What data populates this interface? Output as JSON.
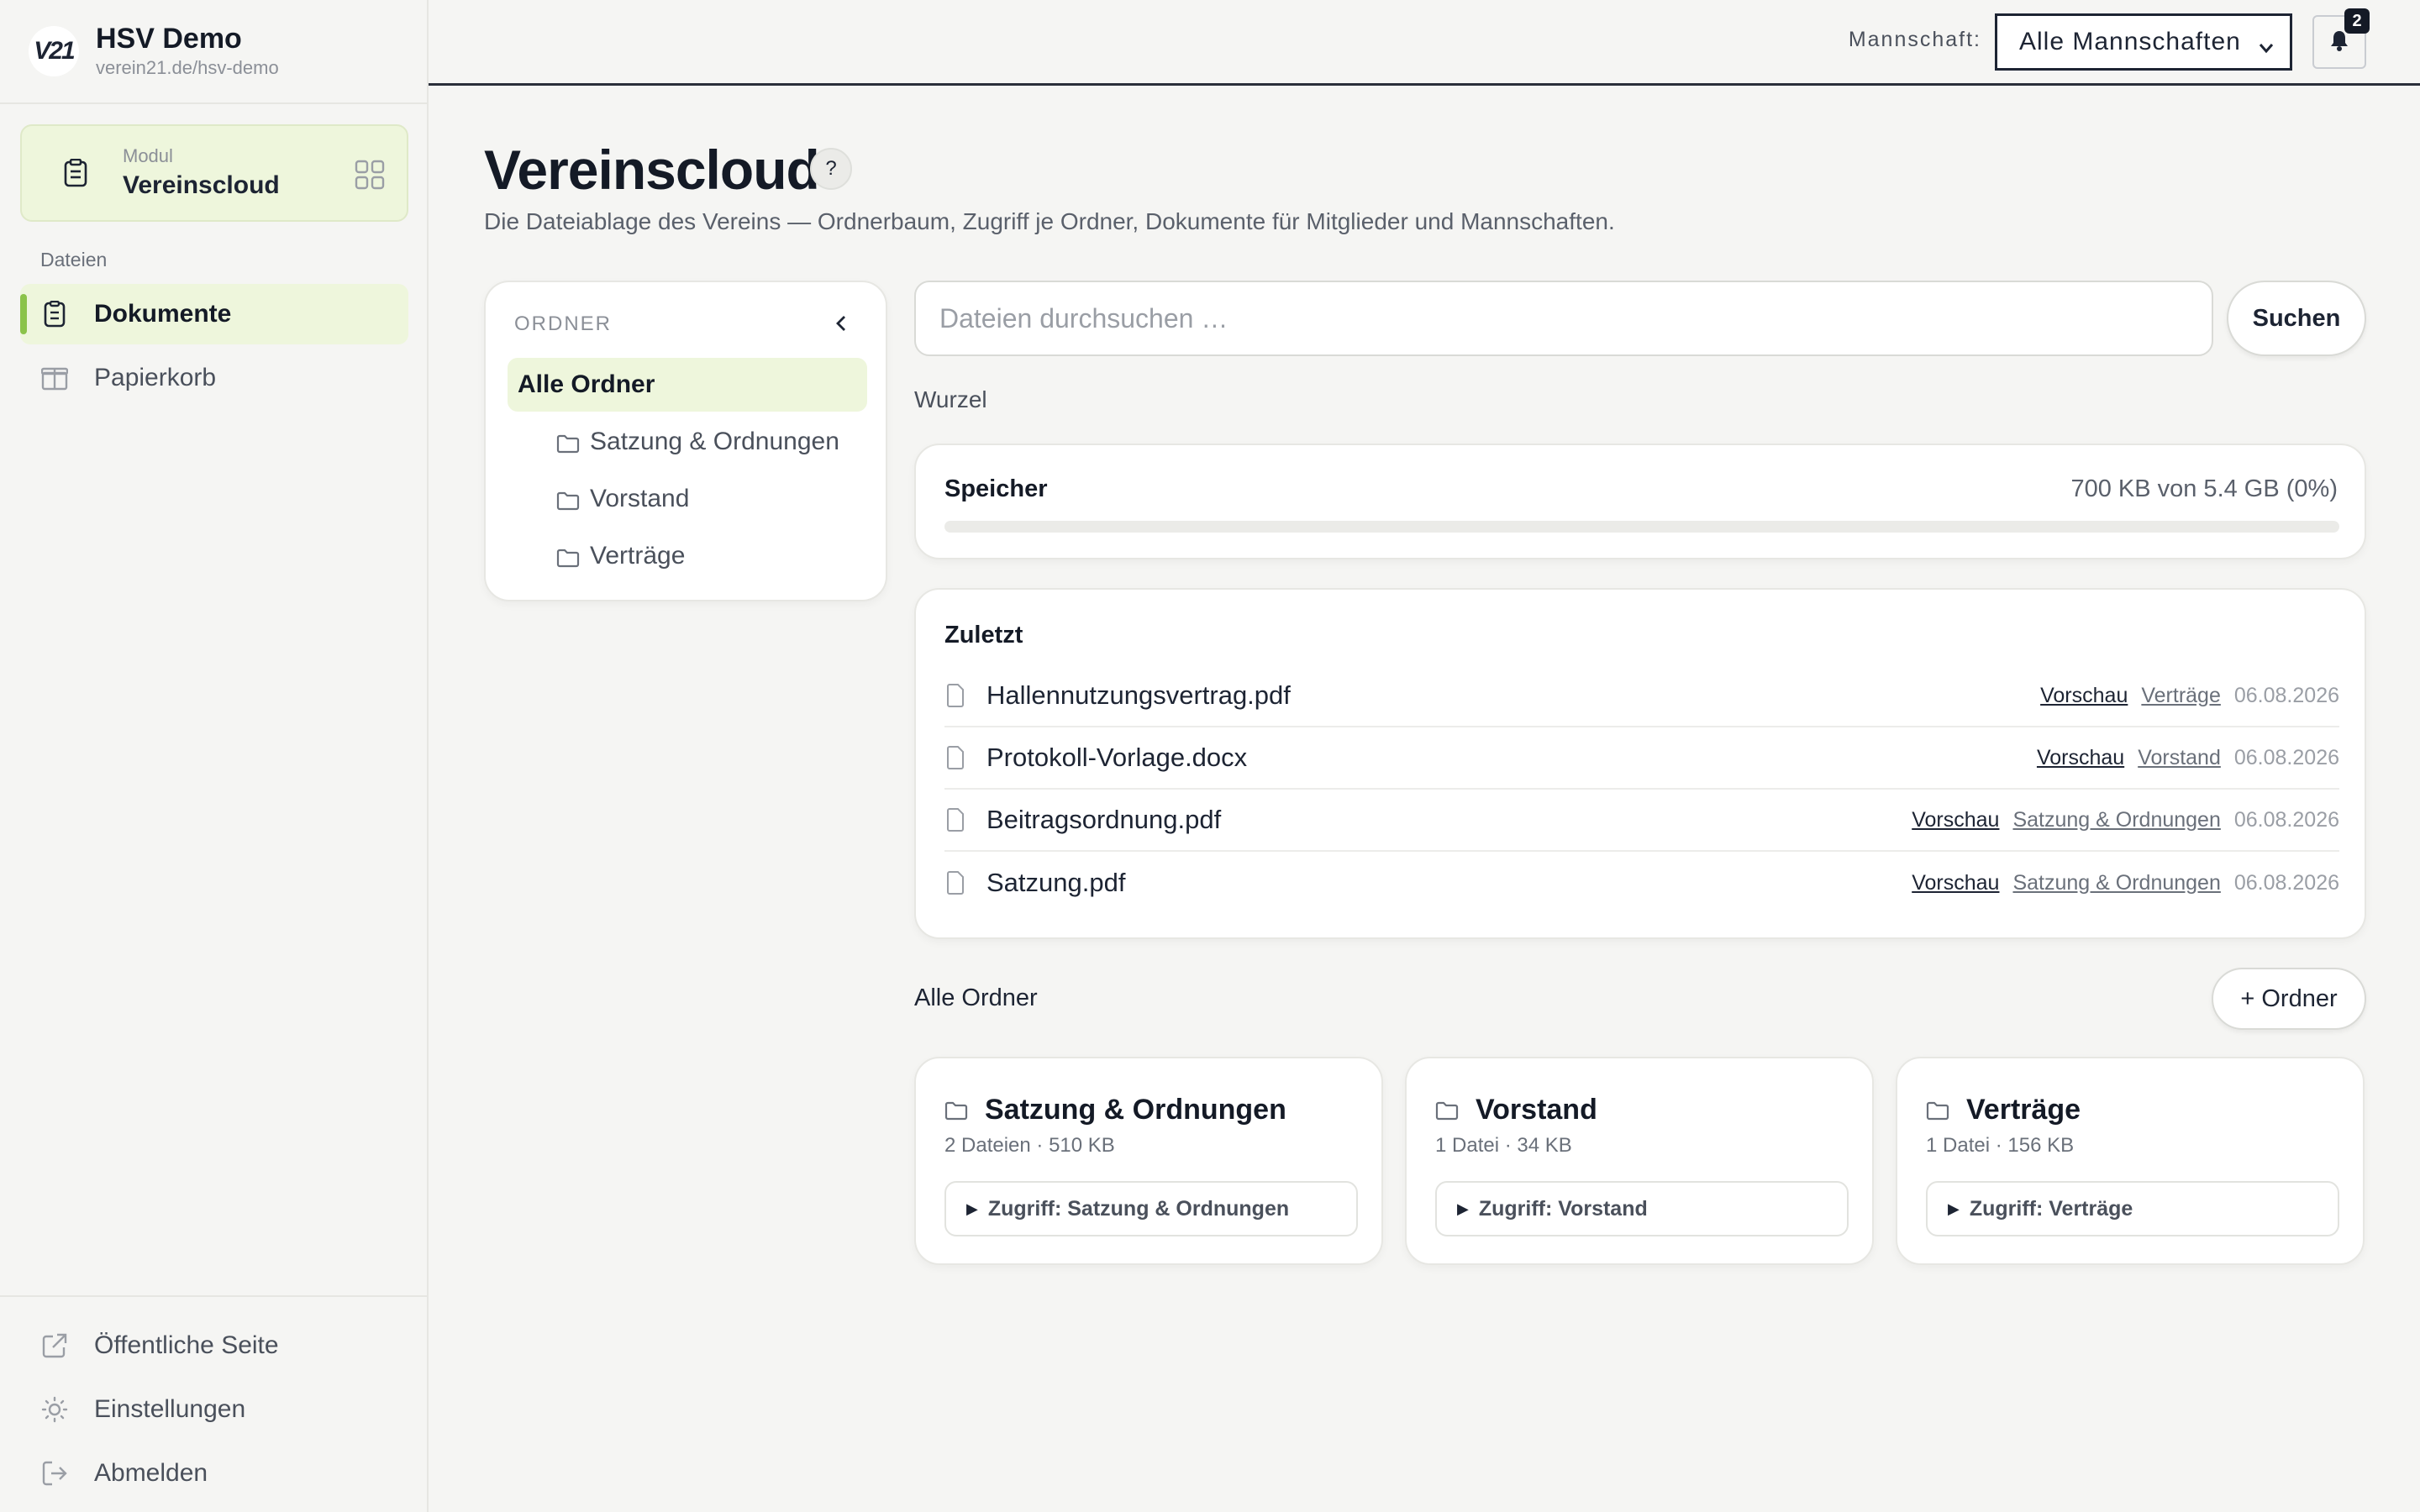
{
  "brand": {
    "logo": "V21",
    "name": "HSV Demo",
    "url": "verein21.de/hsv-demo"
  },
  "module": {
    "label": "Modul",
    "name": "Vereinscloud"
  },
  "sidebar": {
    "section_title": "Dateien",
    "items": [
      {
        "label": "Dokumente",
        "icon": "document-icon",
        "active": true
      },
      {
        "label": "Papierkorb",
        "icon": "trash-box-icon",
        "active": false
      }
    ],
    "bottom_items": [
      {
        "label": "Öffentliche Seite",
        "icon": "external-link-icon"
      },
      {
        "label": "Einstellungen",
        "icon": "sun-gear-icon"
      },
      {
        "label": "Abmelden",
        "icon": "logout-icon"
      }
    ]
  },
  "topbar": {
    "team_label": "Mannschaft:",
    "team_select_value": "Alle Mannschaften",
    "notification_count": "2"
  },
  "page": {
    "title": "Vereinscloud",
    "help": "?",
    "subtitle": "Die Dateiablage des Vereins — Ordnerbaum, Zugriff je Ordner, Dokumente für Mitglieder und Mannschaften."
  },
  "folder_panel": {
    "header": "ORDNER",
    "items": [
      {
        "label": "Alle Ordner",
        "active": true
      },
      {
        "label": "Satzung & Ordnungen",
        "active": false
      },
      {
        "label": "Vorstand",
        "active": false
      },
      {
        "label": "Verträge",
        "active": false
      }
    ]
  },
  "search": {
    "placeholder": "Dateien durchsuchen …",
    "button": "Suchen"
  },
  "breadcrumb": "Wurzel",
  "storage": {
    "title": "Speicher",
    "value": "700 KB von 5.4 GB (0%)",
    "percent": 0
  },
  "recent": {
    "title": "Zuletzt",
    "files": [
      {
        "name": "Hallennutzungsvertrag.pdf",
        "preview": "Vorschau",
        "folder": "Verträge",
        "date": "06.08.2026"
      },
      {
        "name": "Protokoll-Vorlage.docx",
        "preview": "Vorschau",
        "folder": "Vorstand",
        "date": "06.08.2026"
      },
      {
        "name": "Beitragsordnung.pdf",
        "preview": "Vorschau",
        "folder": "Satzung & Ordnungen",
        "date": "06.08.2026"
      },
      {
        "name": "Satzung.pdf",
        "preview": "Vorschau",
        "folder": "Satzung & Ordnungen",
        "date": "06.08.2026"
      }
    ]
  },
  "all_folders": {
    "label": "Alle Ordner",
    "new_button": "+ Ordner",
    "folders": [
      {
        "name": "Satzung & Ordnungen",
        "stats": "2 Dateien · 510 KB",
        "access": "Zugriff: Satzung & Ordnungen"
      },
      {
        "name": "Vorstand",
        "stats": "1 Datei · 34 KB",
        "access": "Zugriff: Vorstand"
      },
      {
        "name": "Verträge",
        "stats": "1 Datei · 156 KB",
        "access": "Zugriff: Verträge"
      }
    ]
  },
  "colors": {
    "accent": "#8bc34a",
    "accent_bg": "#eef6dc",
    "text_dark": "#141a26",
    "background": "#f5f5f3"
  }
}
